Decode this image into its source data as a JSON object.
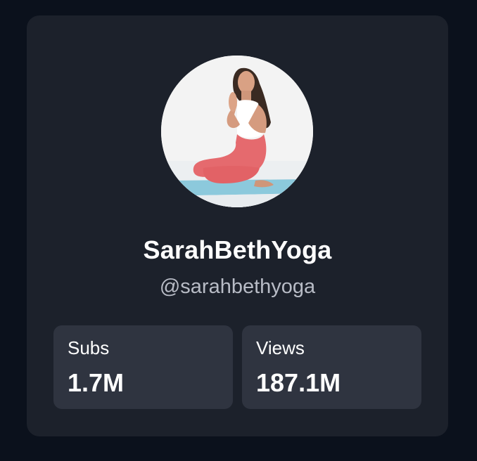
{
  "profile": {
    "display_name": "SarahBethYoga",
    "handle": "@sarahbethyoga",
    "avatar_icon": "profile-photo"
  },
  "stats": [
    {
      "label": "Subs",
      "value": "1.7M"
    },
    {
      "label": "Views",
      "value": "187.1M"
    }
  ],
  "colors": {
    "page_bg": "#0b111c",
    "card_bg": "#1c212b",
    "stat_bg": "#2f3440",
    "text_primary": "#ffffff",
    "text_secondary": "#b8bcc6"
  }
}
